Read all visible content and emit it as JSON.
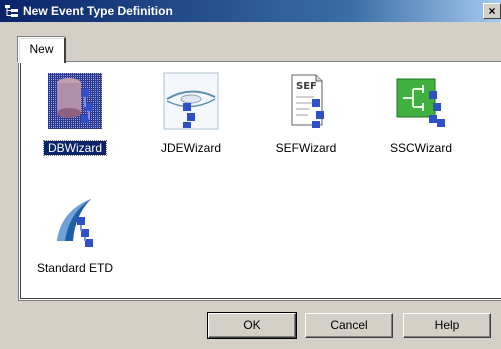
{
  "window": {
    "title": "New Event Type Definition",
    "close_label": "×",
    "icon": "tree-window-icon"
  },
  "tabs": [
    {
      "label": "New"
    }
  ],
  "items": [
    {
      "label": "DBWizard",
      "icon": "database-wizard-icon",
      "selected": true
    },
    {
      "label": "JDEWizard",
      "icon": "jde-wizard-icon",
      "selected": false
    },
    {
      "label": "SEFWizard",
      "icon": "sef-document-wizard-icon",
      "selected": false
    },
    {
      "label": "SSCWizard",
      "icon": "ssc-network-wizard-icon",
      "selected": false
    },
    {
      "label": "Standard ETD",
      "icon": "standard-etd-icon",
      "selected": false
    }
  ],
  "buttons": {
    "ok_label": "OK",
    "cancel_label": "Cancel",
    "help_label": "Help"
  },
  "colors": {
    "title_bar": "#0a246a",
    "selection": "#0a246a",
    "face": "#d4d0c8"
  }
}
